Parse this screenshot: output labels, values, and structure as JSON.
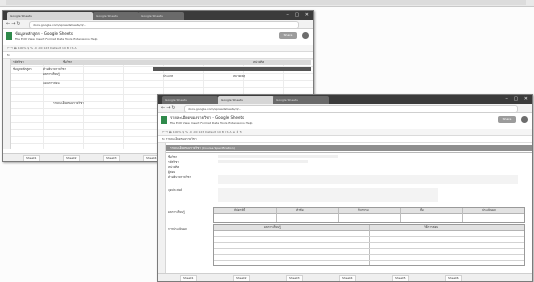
{
  "window_back": {
    "tabs": [
      "Google Sheets",
      "Google Sheets",
      "Google Sheets"
    ],
    "url": "docs.google.com/spreadsheets/d/...",
    "doc_title": "ข้อมูลหลักสูตร - Google Sheets",
    "menu": "File  Edit  View  Insert  Format  Data  Tools  Extensions  Help",
    "share_label": "Share",
    "toolbar": "↶ ↷ 🖶  100%  $ % .0 .00 123  Default  10  B I S A",
    "formula": "fx",
    "cells": [
      "รหัสวิชา",
      "ชื่อวิชา",
      "หน่วยกิต",
      "ข้อมูลหลักสูตร",
      "คำอธิบายรายวิชา",
      "ผลการเรียนรู้",
      "ประเภท",
      "หมายเหตุ",
      "แผนการสอน",
      "รายละเอียดของรายวิชา"
    ],
    "sheet_tabs": [
      "Sheet1",
      "Sheet2",
      "Sheet3",
      "Sheet4",
      "Sheet5"
    ]
  },
  "window_front": {
    "tabs": [
      "Google Sheets",
      "Google Sheets",
      "Google Sheets"
    ],
    "url": "docs.google.com/spreadsheets/d/...",
    "doc_title": "รายละเอียดของรายวิชา - Google Sheets",
    "menu": "File  Edit  View  Insert  Format  Data  Tools  Extensions  Help",
    "share_label": "Share",
    "toolbar": "↶ ↷ 🖶  100%  $ % .0 .00 123  Default  10  B I S A  ≡ ⇕ ↻",
    "formula": "fx  รายละเอียดของรายวิชา",
    "section_title": "รายละเอียดของรายวิชา (Course Specification)",
    "fields": [
      "ชื่อวิชา",
      "รหัสวิชา",
      "หน่วยกิต",
      "ผู้สอน",
      "คำอธิบายรายวิชา",
      "จุดประสงค์",
      "ผลการเรียนรู้",
      "การประเมินผล"
    ],
    "columns": [
      "สัปดาห์ที่",
      "หัวข้อ",
      "กิจกรรม",
      "สื่อ",
      "ประเมินผล"
    ],
    "bottom_columns": [
      "ผลการเรียนรู้",
      "วิธีการสอน"
    ],
    "sheet_tabs": [
      "Sheet1",
      "Sheet2",
      "Sheet3",
      "Sheet4",
      "Sheet5",
      "Sheet6"
    ]
  }
}
